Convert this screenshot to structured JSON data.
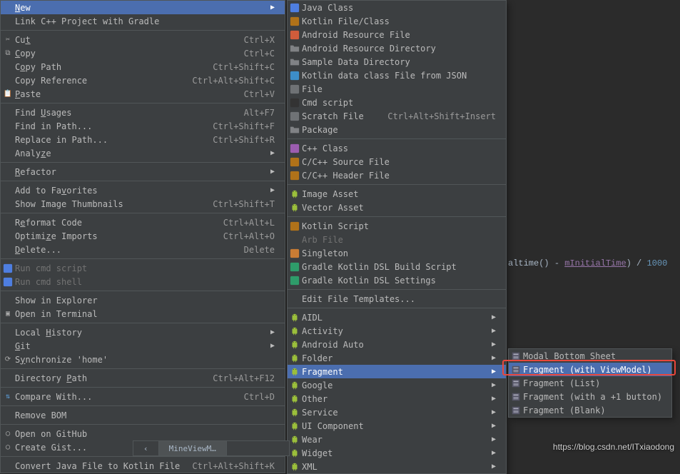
{
  "menu1": {
    "groups": [
      [
        {
          "label": "New",
          "mn": "N",
          "shortcut": "",
          "arrow": true,
          "selected": true,
          "disabled": false,
          "icon": ""
        },
        {
          "label": "Link C++ Project with Gradle",
          "mn": "",
          "shortcut": "",
          "arrow": false,
          "selected": false,
          "disabled": false,
          "icon": ""
        }
      ],
      [
        {
          "label": "Cut",
          "mn": "t",
          "shortcut": "Ctrl+X",
          "arrow": false,
          "selected": false,
          "disabled": false,
          "icon": "cut"
        },
        {
          "label": "Copy",
          "mn": "C",
          "shortcut": "Ctrl+C",
          "arrow": false,
          "selected": false,
          "disabled": false,
          "icon": "copy"
        },
        {
          "label": "Copy Path",
          "mn": "o",
          "shortcut": "Ctrl+Shift+C",
          "arrow": false,
          "selected": false,
          "disabled": false,
          "icon": ""
        },
        {
          "label": "Copy Reference",
          "mn": "",
          "shortcut": "Ctrl+Alt+Shift+C",
          "arrow": false,
          "selected": false,
          "disabled": false,
          "icon": ""
        },
        {
          "label": "Paste",
          "mn": "P",
          "shortcut": "Ctrl+V",
          "arrow": false,
          "selected": false,
          "disabled": false,
          "icon": "paste"
        }
      ],
      [
        {
          "label": "Find Usages",
          "mn": "U",
          "shortcut": "Alt+F7",
          "arrow": false,
          "selected": false,
          "disabled": false,
          "icon": ""
        },
        {
          "label": "Find in Path...",
          "mn": "",
          "shortcut": "Ctrl+Shift+F",
          "arrow": false,
          "selected": false,
          "disabled": false,
          "icon": ""
        },
        {
          "label": "Replace in Path...",
          "mn": "",
          "shortcut": "Ctrl+Shift+R",
          "arrow": false,
          "selected": false,
          "disabled": false,
          "icon": ""
        },
        {
          "label": "Analyze",
          "mn": "z",
          "shortcut": "",
          "arrow": true,
          "selected": false,
          "disabled": false,
          "icon": ""
        }
      ],
      [
        {
          "label": "Refactor",
          "mn": "R",
          "shortcut": "",
          "arrow": true,
          "selected": false,
          "disabled": false,
          "icon": ""
        }
      ],
      [
        {
          "label": "Add to Favorites",
          "mn": "v",
          "shortcut": "",
          "arrow": true,
          "selected": false,
          "disabled": false,
          "icon": ""
        },
        {
          "label": "Show Image Thumbnails",
          "mn": "",
          "shortcut": "Ctrl+Shift+T",
          "arrow": false,
          "selected": false,
          "disabled": false,
          "icon": ""
        }
      ],
      [
        {
          "label": "Reformat Code",
          "mn": "e",
          "shortcut": "Ctrl+Alt+L",
          "arrow": false,
          "selected": false,
          "disabled": false,
          "icon": ""
        },
        {
          "label": "Optimize Imports",
          "mn": "z",
          "shortcut": "Ctrl+Alt+O",
          "arrow": false,
          "selected": false,
          "disabled": false,
          "icon": ""
        },
        {
          "label": "Delete...",
          "mn": "D",
          "shortcut": "Delete",
          "arrow": false,
          "selected": false,
          "disabled": false,
          "icon": ""
        }
      ],
      [
        {
          "label": "Run cmd script",
          "mn": "",
          "shortcut": "",
          "arrow": false,
          "selected": false,
          "disabled": true,
          "icon": "cmd"
        },
        {
          "label": "Run cmd shell",
          "mn": "",
          "shortcut": "",
          "arrow": false,
          "selected": false,
          "disabled": true,
          "icon": "cmd"
        }
      ],
      [
        {
          "label": "Show in Explorer",
          "mn": "",
          "shortcut": "",
          "arrow": false,
          "selected": false,
          "disabled": false,
          "icon": ""
        },
        {
          "label": "Open in Terminal",
          "mn": "",
          "shortcut": "",
          "arrow": false,
          "selected": false,
          "disabled": false,
          "icon": "term"
        }
      ],
      [
        {
          "label": "Local History",
          "mn": "H",
          "shortcut": "",
          "arrow": true,
          "selected": false,
          "disabled": false,
          "icon": ""
        },
        {
          "label": "Git",
          "mn": "G",
          "shortcut": "",
          "arrow": true,
          "selected": false,
          "disabled": false,
          "icon": ""
        },
        {
          "label": "Synchronize 'home'",
          "mn": "y",
          "shortcut": "",
          "arrow": false,
          "selected": false,
          "disabled": false,
          "icon": "sync"
        }
      ],
      [
        {
          "label": "Directory Path",
          "mn": "P",
          "shortcut": "Ctrl+Alt+F12",
          "arrow": false,
          "selected": false,
          "disabled": false,
          "icon": ""
        }
      ],
      [
        {
          "label": "Compare With...",
          "mn": "",
          "shortcut": "Ctrl+D",
          "arrow": false,
          "selected": false,
          "disabled": false,
          "icon": "diff"
        }
      ],
      [
        {
          "label": "Remove BOM",
          "mn": "",
          "shortcut": "",
          "arrow": false,
          "selected": false,
          "disabled": false,
          "icon": ""
        }
      ],
      [
        {
          "label": "Open on GitHub",
          "mn": "",
          "shortcut": "",
          "arrow": false,
          "selected": false,
          "disabled": false,
          "icon": "gh"
        },
        {
          "label": "Create Gist...",
          "mn": "",
          "shortcut": "",
          "arrow": false,
          "selected": false,
          "disabled": false,
          "icon": "gh"
        }
      ],
      [
        {
          "label": "Convert Java File to Kotlin File",
          "mn": "",
          "shortcut": "Ctrl+Alt+Shift+K",
          "arrow": false,
          "selected": false,
          "disabled": false,
          "icon": ""
        }
      ]
    ]
  },
  "menu2": {
    "groups": [
      [
        {
          "label": "Java Class",
          "icon": "class",
          "color": "#4e7ee0",
          "arrow": false
        },
        {
          "label": "Kotlin File/Class",
          "icon": "kt",
          "color": "#b07219",
          "arrow": false
        },
        {
          "label": "Android Resource File",
          "icon": "xml",
          "color": "#d05c3b",
          "arrow": false
        },
        {
          "label": "Android Resource Directory",
          "icon": "folder",
          "color": "#6f7275",
          "arrow": false
        },
        {
          "label": "Sample Data Directory",
          "icon": "folder",
          "color": "#6f7275",
          "arrow": false
        },
        {
          "label": "Kotlin data class File from JSON",
          "icon": "js",
          "color": "#3d8ec9",
          "arrow": false
        },
        {
          "label": "File",
          "icon": "file",
          "color": "#6f7275",
          "arrow": false
        },
        {
          "label": "Cmd script",
          "icon": "cmd",
          "color": "#333",
          "arrow": false
        },
        {
          "label": "Scratch File",
          "icon": "scratch",
          "shortcut": "Ctrl+Alt+Shift+Insert",
          "color": "#6f7275",
          "arrow": false
        },
        {
          "label": "Package",
          "icon": "folder",
          "color": "#6f7275",
          "arrow": false
        }
      ],
      [
        {
          "label": "C++ Class",
          "icon": "s",
          "color": "#9c5db0",
          "arrow": false
        },
        {
          "label": "C/C++ Source File",
          "icon": "c",
          "color": "#b07219",
          "arrow": false
        },
        {
          "label": "C/C++ Header File",
          "icon": "h",
          "color": "#b07219",
          "arrow": false
        }
      ],
      [
        {
          "label": "Image Asset",
          "icon": "android",
          "color": "#9bbf3b",
          "arrow": false
        },
        {
          "label": "Vector Asset",
          "icon": "android",
          "color": "#9bbf3b",
          "arrow": false
        }
      ],
      [
        {
          "label": "Kotlin Script",
          "icon": "kt",
          "color": "#b07219",
          "arrow": false
        },
        {
          "label": "Arb File",
          "icon": "",
          "color": "",
          "arrow": false,
          "disabled": true
        },
        {
          "label": "Singleton",
          "icon": "s",
          "color": "#c97c34",
          "arrow": false
        },
        {
          "label": "Gradle Kotlin DSL Build Script",
          "icon": "g",
          "color": "#2e9c6a",
          "arrow": false
        },
        {
          "label": "Gradle Kotlin DSL Settings",
          "icon": "g",
          "color": "#2e9c6a",
          "arrow": false
        }
      ],
      [
        {
          "label": "Edit File Templates...",
          "icon": "",
          "arrow": false
        }
      ],
      [
        {
          "label": "AIDL",
          "icon": "android",
          "color": "#9bbf3b",
          "arrow": true
        },
        {
          "label": "Activity",
          "icon": "android",
          "color": "#9bbf3b",
          "arrow": true
        },
        {
          "label": "Android Auto",
          "icon": "android",
          "color": "#9bbf3b",
          "arrow": true
        },
        {
          "label": "Folder",
          "icon": "android",
          "color": "#9bbf3b",
          "arrow": true
        },
        {
          "label": "Fragment",
          "icon": "android",
          "color": "#9bbf3b",
          "arrow": true,
          "selected": true
        },
        {
          "label": "Google",
          "icon": "android",
          "color": "#9bbf3b",
          "arrow": true
        },
        {
          "label": "Other",
          "icon": "android",
          "color": "#9bbf3b",
          "arrow": true
        },
        {
          "label": "Service",
          "icon": "android",
          "color": "#9bbf3b",
          "arrow": true
        },
        {
          "label": "UI Component",
          "icon": "android",
          "color": "#9bbf3b",
          "arrow": true
        },
        {
          "label": "Wear",
          "icon": "android",
          "color": "#9bbf3b",
          "arrow": true
        },
        {
          "label": "Widget",
          "icon": "android",
          "color": "#9bbf3b",
          "arrow": true
        },
        {
          "label": "XML",
          "icon": "android",
          "color": "#9bbf3b",
          "arrow": true
        }
      ]
    ]
  },
  "menu3": {
    "items": [
      {
        "label": "Modal Bottom Sheet",
        "icon": "frag",
        "selected": false
      },
      {
        "label": "Fragment (with ViewModel)",
        "icon": "frag",
        "selected": true
      },
      {
        "label": "Fragment (List)",
        "icon": "frag",
        "selected": false
      },
      {
        "label": "Fragment (with a +1 button)",
        "icon": "frag",
        "selected": false
      },
      {
        "label": "Fragment (Blank)",
        "icon": "frag",
        "selected": false
      }
    ]
  },
  "code_snippet": {
    "prefix": "altime",
    "suffix": "() - ",
    "field": "mInitialTime",
    "tail": ") / ",
    "num": "1000"
  },
  "tabbar": {
    "active": "MineViewM…"
  },
  "watermark": "https://blog.csdn.net/ITxiaodong"
}
